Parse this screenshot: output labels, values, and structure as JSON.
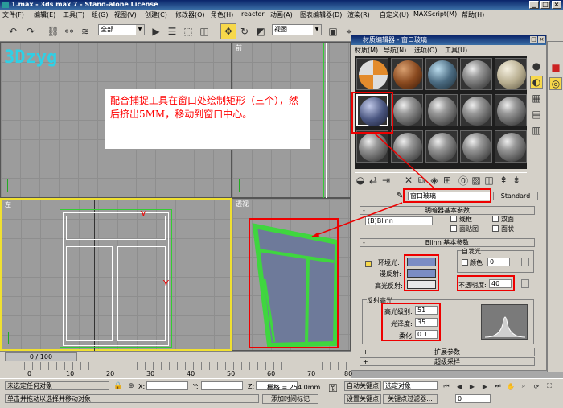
{
  "window": {
    "title": "1.max - 3ds max 7  - Stand-alone License",
    "min": "_",
    "max": "□",
    "close": "×"
  },
  "menu": [
    "文件(F)",
    "编辑(E)",
    "工具(T)",
    "组(G)",
    "视图(V)",
    "创建(C)",
    "修改器(O)",
    "角色(H)",
    "reactor",
    "动画(A)",
    "图表编辑器(D)",
    "渲染(R)",
    "自定义(U)",
    "MAXScript(M)",
    "帮助(H)"
  ],
  "toolbar": {
    "selection_filter": "全部",
    "ref_coord": "视图"
  },
  "viewports": {
    "top_left": "3Dzyg",
    "front": "前",
    "left": "左",
    "persp": "透视"
  },
  "annotation": "配合捕捉工具在窗口处绘制矩形（三个），然后挤出5MM，移动到窗口中心。",
  "timeline": {
    "frame": "0 / 100",
    "ticks": [
      "0",
      "10",
      "20",
      "30",
      "40",
      "50",
      "60",
      "70",
      "80"
    ]
  },
  "material_editor": {
    "title": "材质编辑器 - 窗口玻璃",
    "menu": [
      "材质(M)",
      "导航(N)",
      "选项(O)",
      "工具(U)"
    ],
    "material_name": "窗口玻璃",
    "material_type": "Standard",
    "shader_section": "明暗器基本参数",
    "shader": "(B)Blinn",
    "checks": {
      "wire": "线框",
      "two_sided": "双面",
      "face_map": "面贴图",
      "faceted": "面状"
    },
    "blinn_section": "Blinn 基本参数",
    "self_illum": {
      "group": "自发光",
      "color": "颜色",
      "value": "0"
    },
    "ambient": "环境光:",
    "diffuse": "漫反射:",
    "specular": "高光反射:",
    "opacity": {
      "label": "不透明度:",
      "value": "40"
    },
    "spec_highlights": "反射高光",
    "spec_level": {
      "label": "高光级别:",
      "value": "51"
    },
    "glossiness": {
      "label": "光泽度:",
      "value": "35"
    },
    "soften": {
      "label": "柔化:",
      "value": "0.1"
    },
    "extended": "扩展参数",
    "supersampling": "超级采样"
  },
  "status": {
    "selection": "未选定任何对象",
    "prompt": "单击并拖动以选择并移动对象",
    "x_label": "X:",
    "y_label": "Y:",
    "z_label": "Z:",
    "grid": "栅格 = 254.0mm",
    "add_time_tag": "添加时间标记",
    "auto_key": "自动关键点",
    "set_key": "设置关键点",
    "selected_obj": "选定对象",
    "key_filters": "关键点过滤器...",
    "frame": "0"
  },
  "colors": {
    "annotation_text": "#ff0000",
    "ambient": "#7b8cc4",
    "window_green": "#3fd63f"
  }
}
